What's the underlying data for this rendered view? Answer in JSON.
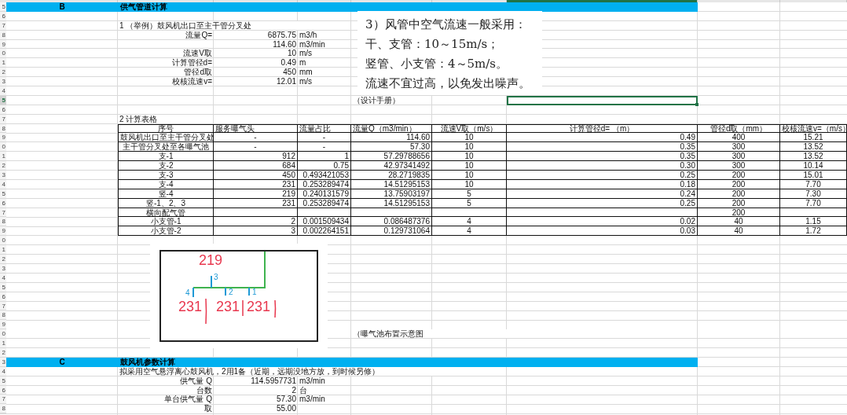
{
  "column_headers": [
    {
      "selected": false
    },
    {
      "selected": false
    },
    {
      "selected": false
    },
    {
      "selected": false
    },
    {
      "selected": false
    },
    {
      "selected": false
    },
    {
      "selected": true
    },
    {
      "selected": false
    },
    {
      "selected": false
    }
  ],
  "row_numbers": [
    {
      "label": "5",
      "selected": false
    },
    {
      "label": "6",
      "selected": false
    },
    {
      "label": "7",
      "selected": false
    },
    {
      "label": "8",
      "selected": false
    },
    {
      "label": "9",
      "selected": false
    },
    {
      "label": "0",
      "selected": false
    },
    {
      "label": "1",
      "selected": false
    },
    {
      "label": "2",
      "selected": false
    },
    {
      "label": "3",
      "selected": false
    },
    {
      "label": "4",
      "selected": false
    },
    {
      "label": "5",
      "selected": true
    },
    {
      "label": "6",
      "selected": false
    },
    {
      "label": "7",
      "selected": false
    },
    {
      "label": "8",
      "selected": false
    },
    {
      "label": "9",
      "selected": false
    },
    {
      "label": "0",
      "selected": false
    },
    {
      "label": "1",
      "selected": false
    },
    {
      "label": "2",
      "selected": false
    },
    {
      "label": "3",
      "selected": false
    },
    {
      "label": "4",
      "selected": false
    },
    {
      "label": "5",
      "selected": false
    },
    {
      "label": "6",
      "selected": false
    },
    {
      "label": "7",
      "selected": false
    },
    {
      "label": "8",
      "selected": false
    },
    {
      "label": "9",
      "selected": false
    },
    {
      "label": "0",
      "selected": false
    },
    {
      "label": "1",
      "selected": false
    },
    {
      "label": "2",
      "selected": false
    },
    {
      "label": "3",
      "selected": false
    },
    {
      "label": "4",
      "selected": false
    },
    {
      "label": "5",
      "selected": false
    },
    {
      "label": "6",
      "selected": false
    },
    {
      "label": "7",
      "selected": false
    },
    {
      "label": "8",
      "selected": false
    },
    {
      "label": "9",
      "selected": false
    },
    {
      "label": "0",
      "selected": false
    },
    {
      "label": "1",
      "selected": false
    },
    {
      "label": "2",
      "selected": false
    },
    {
      "label": "3",
      "selected": false
    },
    {
      "label": "4",
      "selected": false
    },
    {
      "label": "5",
      "selected": false
    },
    {
      "label": "6",
      "selected": false
    },
    {
      "label": "7",
      "selected": false
    },
    {
      "label": "8",
      "selected": false
    }
  ],
  "section_b": {
    "letter": "B",
    "title": "供气管道计算"
  },
  "example": {
    "heading": "1 （举例）鼓风机出口至主干管分叉处",
    "rows": [
      {
        "label": "流量Q=",
        "value": "6875.75",
        "unit": "m3/h"
      },
      {
        "value": "114.60",
        "unit": "m3/min"
      },
      {
        "label": "流速V取",
        "value": "10",
        "unit": "m/s"
      },
      {
        "label": "计算管径d=",
        "value": "0.49",
        "unit": "m"
      },
      {
        "label": "管径d取",
        "value": "450",
        "unit": "mm"
      },
      {
        "label": "校核流速v=",
        "value": "12.01",
        "unit": "m/s"
      }
    ]
  },
  "note_box": {
    "lines": [
      "3）风管中空气流速一般采用：",
      "干、支管：10～15m/s；",
      "竖管、小支管：4～5m/s。",
      "流速不宜过高，以免发出噪声。"
    ]
  },
  "note_source": "（设计手册）",
  "calc_table": {
    "title": "2 计算表格",
    "columns": [
      "序号",
      "服务曝气头",
      "流量占比",
      "流量Q（m3/min）",
      "流速V取（m/s）",
      "计算管径d= （m）",
      "管径d取（mm）",
      "校核流速v=（m/s）"
    ],
    "rows": [
      {
        "kind": "trunk",
        "cells": [
          "鼓风机出口至主干管分叉处",
          "-",
          "-",
          "114.60",
          "10",
          "0.49",
          "400",
          "15.21"
        ]
      },
      {
        "kind": "trunk",
        "cells": [
          "主干管分叉处至各曝气池",
          "-",
          "-",
          "57.30",
          "10",
          "0.35",
          "300",
          "13.52"
        ]
      },
      {
        "kind": "branch",
        "cells": [
          "支-1",
          "912",
          "1",
          "57.29788656",
          "10",
          "0.35",
          "300",
          "13.52"
        ]
      },
      {
        "kind": "branch",
        "cells": [
          "支-2",
          "684",
          "0.75",
          "42.97341492",
          "10",
          "0.30",
          "300",
          "10.14"
        ]
      },
      {
        "kind": "branch",
        "cells": [
          "支-3",
          "450",
          "0.493421053",
          "28.2719835",
          "10",
          "0.25",
          "200",
          "15.01"
        ]
      },
      {
        "kind": "branch",
        "cells": [
          "支-4",
          "231",
          "0.253289474",
          "14.51295153",
          "10",
          "0.18",
          "200",
          "7.70"
        ]
      },
      {
        "kind": "branch",
        "cells": [
          "竖-4",
          "219",
          "0.240131579",
          "13.75903197",
          "5",
          "0.24",
          "200",
          "7.30"
        ]
      },
      {
        "kind": "branch",
        "cells": [
          "竖-1、2、3",
          "231",
          "0.253289474",
          "14.51295153",
          "5",
          "0.25",
          "200",
          "7.70"
        ]
      },
      {
        "kind": "branch",
        "cells": [
          "横向配气管",
          null,
          null,
          null,
          null,
          null,
          "200",
          null
        ]
      },
      {
        "kind": "branch",
        "cells": [
          "小支管-1",
          "2",
          "0.001509434",
          "0.086487376",
          "4",
          "0.02",
          "40",
          "1.15"
        ]
      },
      {
        "kind": "branch",
        "cells": [
          "小支管-2",
          "3",
          "0.002264151",
          "0.129731064",
          "4",
          "0.03",
          "40",
          "1.72"
        ]
      }
    ]
  },
  "sketch": {
    "labels": [
      {
        "text": "219",
        "kind": "count"
      },
      {
        "text": "3",
        "kind": "branch"
      },
      {
        "text": "4",
        "kind": "branch"
      },
      {
        "text": "2",
        "kind": "branch"
      },
      {
        "text": "1",
        "kind": "branch"
      },
      {
        "text": "231",
        "kind": "count"
      },
      {
        "text": "231",
        "kind": "count"
      },
      {
        "text": "231",
        "kind": "count"
      }
    ],
    "caption": "（曝气池布置示意图"
  },
  "section_c": {
    "letter": "C",
    "title": "鼓风机参数计算"
  },
  "blower": {
    "note": "拟采用空气悬浮离心鼓风机，2用1备（近期，远期没地方放，到时候另修）",
    "rows": [
      {
        "label": "供气量 Q",
        "value": "114.5957731",
        "unit": "m3/min"
      },
      {
        "label": "台数",
        "value": "2",
        "unit": "台"
      },
      {
        "label": "单台供气量 Q",
        "value": "57.30",
        "unit": "m3/min"
      },
      {
        "label": "取",
        "value": "55.00"
      }
    ]
  }
}
